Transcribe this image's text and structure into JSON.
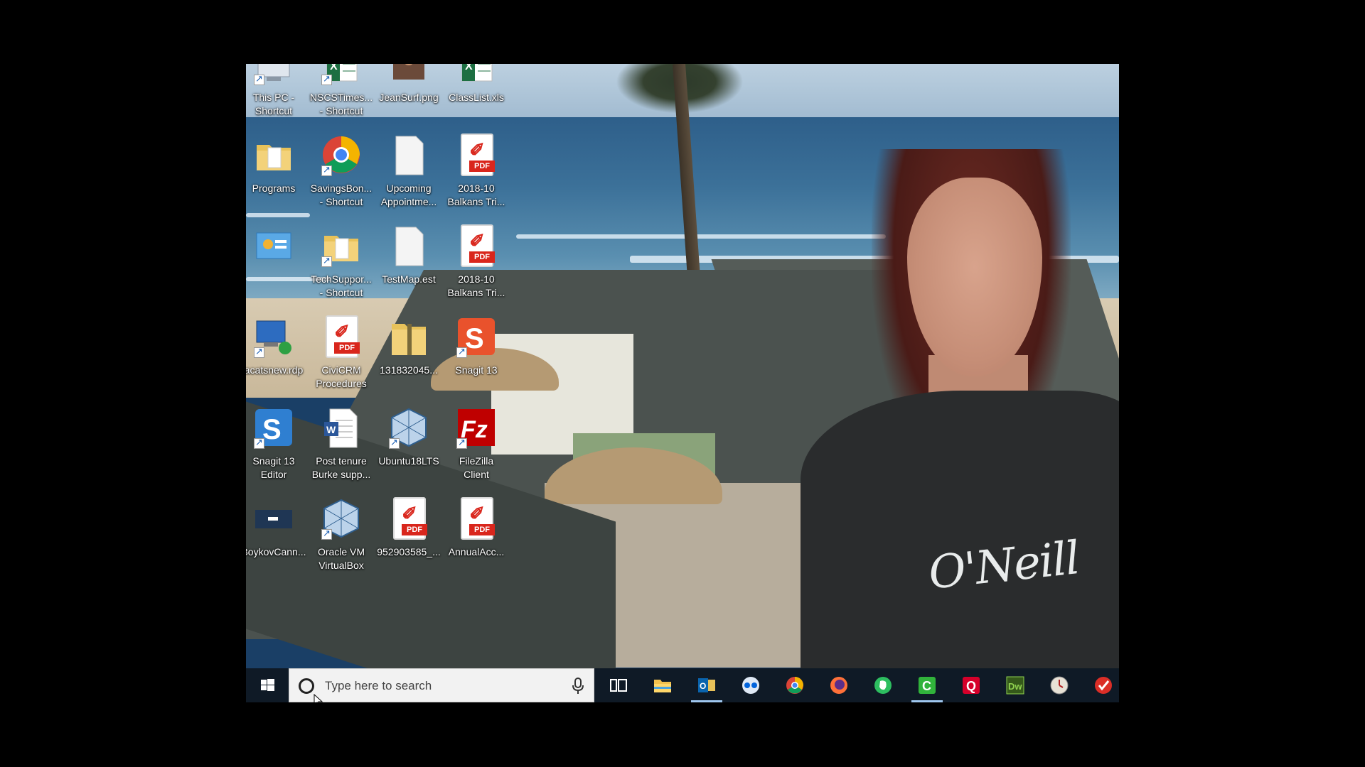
{
  "desktop": {
    "icons": [
      {
        "label_line1": "This PC -",
        "label_line2": "Shortcut",
        "icon": "computer-icon"
      },
      {
        "label_line1": "NSCSTimes...",
        "label_line2": "- Shortcut",
        "icon": "excel-icon"
      },
      {
        "label_line1": "JeanSurf.png",
        "label_line2": "",
        "icon": "image-icon"
      },
      {
        "label_line1": "ClassList.xls",
        "label_line2": "",
        "icon": "excel-icon"
      },
      {
        "label_line1": "Programs",
        "label_line2": "",
        "icon": "folder-icon"
      },
      {
        "label_line1": "SavingsBon...",
        "label_line2": "- Shortcut",
        "icon": "chrome-icon"
      },
      {
        "label_line1": "Upcoming",
        "label_line2": "Appointme...",
        "icon": "blank-file-icon"
      },
      {
        "label_line1": "2018-10",
        "label_line2": "Balkans Tri...",
        "icon": "pdf-icon"
      },
      {
        "label_line1": "",
        "label_line2": "",
        "icon": "control-panel-icon"
      },
      {
        "label_line1": "TechSuppor...",
        "label_line2": "- Shortcut",
        "icon": "folder-icon"
      },
      {
        "label_line1": "TestMap.est",
        "label_line2": "",
        "icon": "blank-file-icon"
      },
      {
        "label_line1": "2018-10",
        "label_line2": "Balkans Tri...",
        "icon": "pdf-icon"
      },
      {
        "label_line1": "acatsnew.rdp",
        "label_line2": "",
        "icon": "remote-desktop-icon"
      },
      {
        "label_line1": "CiviCRM",
        "label_line2": "Procedures",
        "icon": "pdf-icon"
      },
      {
        "label_line1": "131832045...",
        "label_line2": "",
        "icon": "zip-folder-icon"
      },
      {
        "label_line1": "Snagit 13",
        "label_line2": "",
        "icon": "snagit-icon"
      },
      {
        "label_line1": "Snagit 13",
        "label_line2": "Editor",
        "icon": "snagit-editor-icon"
      },
      {
        "label_line1": "Post tenure",
        "label_line2": "Burke supp...",
        "icon": "word-icon"
      },
      {
        "label_line1": "Ubuntu18LTS",
        "label_line2": "",
        "icon": "virtualbox-icon"
      },
      {
        "label_line1": "FileZilla",
        "label_line2": "Client",
        "icon": "filezilla-icon"
      },
      {
        "label_line1": "BoykovCann...",
        "label_line2": "",
        "icon": "file-icon"
      },
      {
        "label_line1": "Oracle VM",
        "label_line2": "VirtualBox",
        "icon": "virtualbox-icon"
      },
      {
        "label_line1": "952903585_...",
        "label_line2": "",
        "icon": "pdf-icon"
      },
      {
        "label_line1": "AnnualAcc...",
        "label_line2": "",
        "icon": "pdf-icon"
      }
    ],
    "pdf_tag": "PDF",
    "pdf_glyph": "✐",
    "wallpaper_text": "O'Neill"
  },
  "taskbar": {
    "search_placeholder": "Type here to search",
    "apps": [
      {
        "name": "task-view-icon",
        "active": false
      },
      {
        "name": "file-explorer-icon",
        "active": false
      },
      {
        "name": "outlook-icon",
        "active": true
      },
      {
        "name": "flickr-icon",
        "active": false
      },
      {
        "name": "chrome-icon",
        "active": false
      },
      {
        "name": "firefox-icon",
        "active": false
      },
      {
        "name": "evernote-icon",
        "active": false
      },
      {
        "name": "camtasia-icon",
        "active": true
      },
      {
        "name": "quicken-icon",
        "active": false
      },
      {
        "name": "dreamweaver-icon",
        "active": false
      },
      {
        "name": "clock-app-icon",
        "active": false
      },
      {
        "name": "todo-check-icon",
        "active": false
      }
    ],
    "dreamweaver_text": "Dw",
    "quicken_text": "Q",
    "word_text": "W"
  },
  "colors": {
    "taskbar_bg": "#0f1a26",
    "search_bg": "#f2f2f2",
    "pdf_red": "#d9261c",
    "active_indicator": "#9fc7ef"
  }
}
